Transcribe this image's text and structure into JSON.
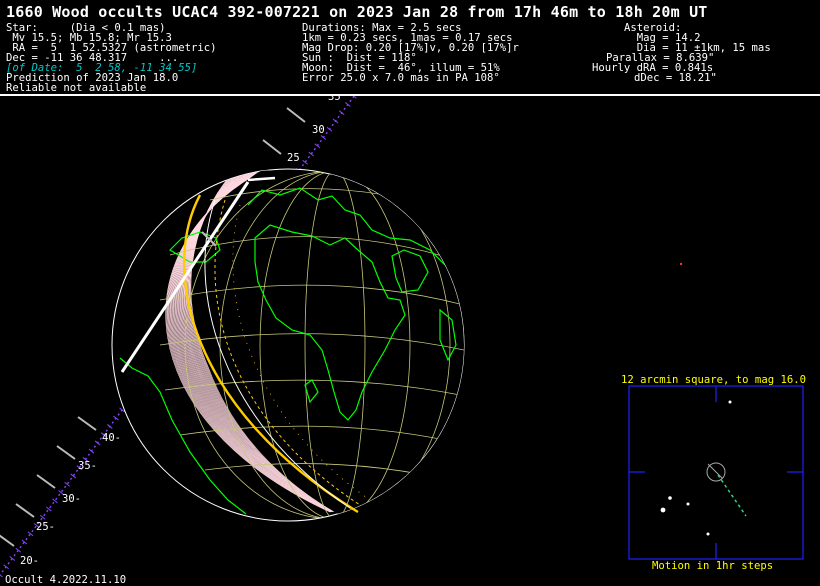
{
  "title": "1660 Wood occults UCAC4 392-007221 on 2023 Jan 28 from 17h 46m to 18h 20m UT",
  "star_block": [
    "Star:     (Dia < 0.1 mas)",
    " Mv 15.5; Mb 15.8; Mr 15.3",
    " RA =  5  1 52.5327 (astrometric)",
    "Dec = -11 36 48.317     ..."
  ],
  "star_of_date": "[of Date:  5  2 58, -11 34 55]",
  "prediction": "Prediction of 2023 Jan 18.0",
  "reliable": "Reliable not available",
  "mid_block": [
    "Durations: Max = 2.5 secs",
    "1km = 0.23 secs, 1mas = 0.17 secs",
    "Mag Drop: 0.20 [17%]v, 0.20 [17%]r",
    "Sun :  Dist = 118°",
    "Moon:  Dist =  46°, illum = 51%",
    "Error 25.0 x 7.0 mas in PA 108°"
  ],
  "asteroid_block": [
    "Asteroid:",
    "  Mag = 14.2",
    "  Dia = 11 ±1km, 15 mas",
    "Parallax = 8.639\"",
    "Hourly dRA = 0.841s",
    "dDec = 18.21\""
  ],
  "path_labels": {
    "upper": [
      "35",
      "30",
      "25"
    ],
    "lower": [
      "40-",
      "35-",
      "30-",
      "25-",
      "20-"
    ]
  },
  "finder": {
    "title": "12 arcmin square, to mag 16.0",
    "motion": "Motion in 1hr steps"
  },
  "footer": "Occult 4.2022.11.10",
  "colors": {
    "background": "#000000",
    "text": "#ffffff",
    "of_date": "#00c8c8",
    "land": "#00ff00",
    "graticule": "#c8c87a",
    "path_limit": "#ffcc00",
    "ground_track": "#8844ff",
    "finder_frame": "#2020ff",
    "finder_text": "#ffff00"
  }
}
